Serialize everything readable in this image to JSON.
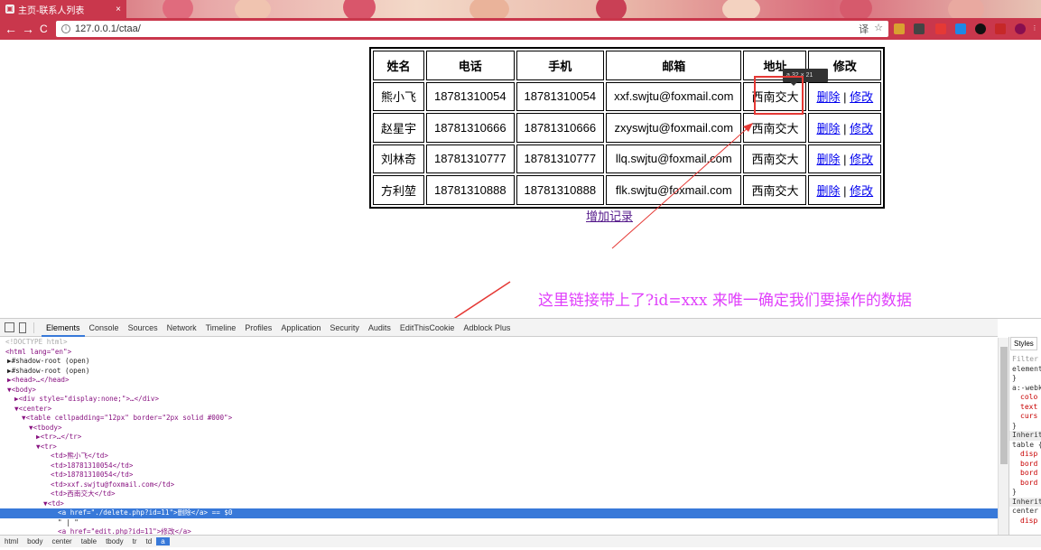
{
  "browser": {
    "tab_title": "主页-联系人列表",
    "tab_close": "×",
    "url": "127.0.0.1/ctaa/",
    "back": "←",
    "forward": "→",
    "reload": "C",
    "translate": "译",
    "bookmark": "☆"
  },
  "table": {
    "headers": [
      "姓名",
      "电话",
      "手机",
      "邮箱",
      "地址",
      "修改"
    ],
    "rows": [
      {
        "name": "熊小飞",
        "phone": "18781310054",
        "mobile": "18781310054",
        "email": "xxf.swjtu@foxmail.com",
        "address": "西南交大"
      },
      {
        "name": "赵星宇",
        "phone": "18781310666",
        "mobile": "18781310666",
        "email": "zxyswjtu@foxmail.com",
        "address": "西南交大"
      },
      {
        "name": "刘林奇",
        "phone": "18781310777",
        "mobile": "18781310777",
        "email": "llq.swjtu@foxmail.com",
        "address": "西南交大"
      },
      {
        "name": "方利堃",
        "phone": "18781310888",
        "mobile": "18781310888",
        "email": "flk.swjtu@foxmail.com",
        "address": "西南交大"
      }
    ],
    "delete_label": "删除",
    "separator": " | ",
    "edit_label": "修改"
  },
  "add_record": "增加记录",
  "tooltip": "a  32 × 21",
  "annotation": "这里链接带上了?id=xxx  来唯一确定我们要操作的数据",
  "devtools": {
    "tabs": [
      "Elements",
      "Console",
      "Sources",
      "Network",
      "Timeline",
      "Profiles",
      "Application",
      "Security",
      "Audits",
      "EditThisCookie",
      "Adblock Plus"
    ],
    "active_tab": "Elements",
    "styles_tab": "Styles",
    "styles_lines": [
      "Filter",
      "element",
      "}",
      "a:-webk",
      "colo",
      "text",
      "curs",
      "}",
      "Inherited",
      "table {",
      "disp",
      "bord",
      "bord",
      "bord",
      "}",
      "Inherited",
      "center",
      "disp"
    ],
    "breadcrumbs": [
      "html",
      "body",
      "center",
      "table",
      "tbody",
      "tr",
      "td",
      "a"
    ],
    "active_crumb": "a",
    "dom": {
      "doctype": "<!DOCTYPE html>",
      "html_open": "<html lang=\"en\">",
      "shadow1": "▶#shadow-root (open)",
      "shadow2": "▶#shadow-root (open)",
      "head": "▶<head>…</head>",
      "body": "▼<body>",
      "div_hidden": "▶<div style=\"display:none;\">…</div>",
      "center": "▼<center>",
      "table": "▼<table cellpadding=\"12px\" border=\"2px solid #000\">",
      "tbody": "▼<tbody>",
      "tr_collapsed": "▶<tr>…</tr>",
      "tr_open": "▼<tr>",
      "td1": "<td>熊小飞</td>",
      "td2": "<td>18781310054</td>",
      "td3": "<td>18781310054</td>",
      "td4": "<td>xxf.swjtu@foxmail.com</td>",
      "td5": "<td>西南交大</td>",
      "td6": "▼<td>",
      "a_delete": "<a href=\"./delete.php?id=11\">删除</a> == $0",
      "text_node": "\" | \"",
      "a_edit": "<a href=\"edit.php?id=11\">修改</a>"
    }
  }
}
